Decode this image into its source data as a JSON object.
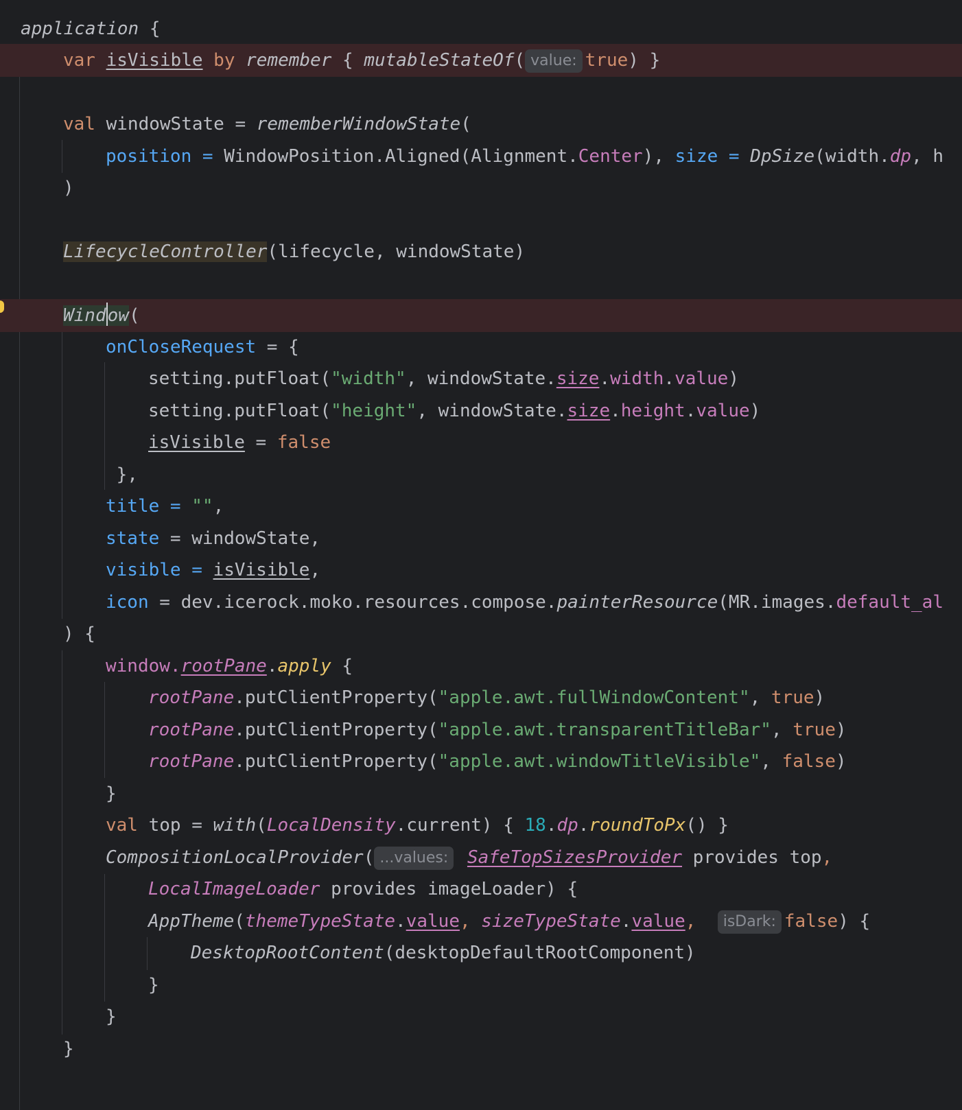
{
  "editor": {
    "language": "kotlin",
    "theme_colors": {
      "background": "#1e1f22",
      "text": "#bcbec4",
      "keyword": "#cf8e6d",
      "named_param": "#56a8f5",
      "string": "#6aab73",
      "property": "#c77dbb",
      "number": "#2aacb8",
      "function_call": "#e8c56b",
      "highlight_line": "#3a2427"
    },
    "lines": {
      "l1": {
        "a": "application",
        "b": " {"
      },
      "l2": {
        "a": "var",
        "b": " ",
        "c": "isVisible",
        "d": " ",
        "e": "by",
        "f": " ",
        "g": "remember",
        "h": " { ",
        "i": "mutableStateOf",
        "j": "(",
        "hint": "value:",
        "k": "true",
        "l": ") }"
      },
      "l4": {
        "a": "val",
        "b": " windowState = ",
        "c": "rememberWindowState",
        "d": "("
      },
      "l5": {
        "a": "position",
        "b": " = ",
        "c": "WindowPosition.Aligned(Alignment.",
        "d": "Center",
        "e": "), ",
        "f": "size",
        "g": " = ",
        "h": "DpSize",
        "i": "(width.",
        "j": "dp",
        "k": ", h"
      },
      "l6": {
        "a": ")"
      },
      "l8": {
        "a": "LifecycleController",
        "b": "(lifecycle, windowState)"
      },
      "l10": {
        "a": "Wind",
        "b": "ow",
        "c": "("
      },
      "l11": {
        "a": "onCloseRequest",
        "b": " = {"
      },
      "l12": {
        "a": "setting.putFloat(",
        "b": "\"width\"",
        "c": ", windowState.",
        "d": "size",
        "e": ".",
        "f": "width",
        "g": ".",
        "h": "value",
        "i": ")"
      },
      "l13": {
        "a": "setting.putFloat(",
        "b": "\"height\"",
        "c": ", windowState.",
        "d": "size",
        "e": ".",
        "f": "height",
        "g": ".",
        "h": "value",
        "i": ")"
      },
      "l14": {
        "a": "isVisible",
        "b": " = ",
        "c": "false"
      },
      "l15": {
        "a": " },",
        "b": ""
      },
      "l16": {
        "a": "title",
        "b": " = ",
        "c": "\"\"",
        "d": ","
      },
      "l17": {
        "a": "state",
        "b": " = windowState,"
      },
      "l18": {
        "a": "visible",
        "b": " = ",
        "c": "isVisible",
        "d": ","
      },
      "l19": {
        "a": "icon",
        "b": " = dev.icerock.moko.resources.compose.",
        "c": "painterResource",
        "d": "(MR.images.",
        "e": "default_al"
      },
      "l20": {
        "a": ") {"
      },
      "l21": {
        "a": "window.",
        "b": "rootPane",
        "c": ".",
        "d": "apply",
        "e": " {"
      },
      "l22": {
        "a": "rootPane",
        "b": ".putClientProperty(",
        "c": "\"apple.awt.fullWindowContent\"",
        "d": ", ",
        "e": "true",
        "f": ")"
      },
      "l23": {
        "a": "rootPane",
        "b": ".putClientProperty(",
        "c": "\"apple.awt.transparentTitleBar\"",
        "d": ", ",
        "e": "true",
        "f": ")"
      },
      "l24": {
        "a": "rootPane",
        "b": ".putClientProperty(",
        "c": "\"apple.awt.windowTitleVisible\"",
        "d": ", ",
        "e": "false",
        "f": ")"
      },
      "l25": {
        "a": "}"
      },
      "l26": {
        "a": "val",
        "b": " top = ",
        "c": "with",
        "d": "(",
        "e": "LocalDensity",
        "f": ".current) { ",
        "g": "18",
        "h": ".",
        "i": "dp",
        "j": ".",
        "k": "roundToPx",
        "l": "() }"
      },
      "l27": {
        "a": "CompositionLocalProvider",
        "b": "(",
        "hint": "...values:",
        "c": "SafeTopSizesProvider",
        "d": " provides top",
        "e": ","
      },
      "l28": {
        "a": "LocalImageLoader",
        "b": " provides imageLoader) {"
      },
      "l29": {
        "a": "AppTheme",
        "b": "(",
        "c": "themeTypeState",
        "d": ".",
        "e": "value",
        "f": ", ",
        "g": "sizeTypeState",
        "h": ".",
        "i": "value",
        "j": ", ",
        "hint": "isDark:",
        "k": "false",
        "l": ") {"
      },
      "l30": {
        "a": "DesktopRootContent",
        "b": "(desktopDefaultRootComponent)"
      },
      "l31": {
        "a": "}"
      },
      "l32": {
        "a": "}"
      },
      "l33": {
        "a": "}"
      }
    }
  }
}
